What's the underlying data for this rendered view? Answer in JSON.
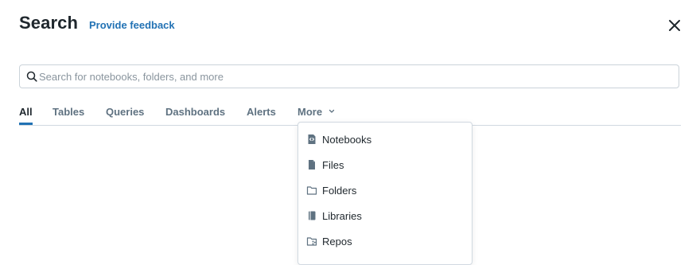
{
  "header": {
    "title": "Search",
    "feedback_link": "Provide feedback",
    "close_icon": "close-icon"
  },
  "search": {
    "placeholder": "Search for notebooks, folders, and more",
    "value": "",
    "icon": "search-icon"
  },
  "tabs": [
    {
      "label": "All",
      "active": true
    },
    {
      "label": "Tables",
      "active": false
    },
    {
      "label": "Queries",
      "active": false
    },
    {
      "label": "Dashboards",
      "active": false
    },
    {
      "label": "Alerts",
      "active": false
    },
    {
      "label": "More",
      "active": false,
      "icon": "chevron-down-icon"
    }
  ],
  "more_menu": {
    "items": [
      {
        "label": "Notebooks",
        "icon": "notebook-icon"
      },
      {
        "label": "Files",
        "icon": "file-icon"
      },
      {
        "label": "Folders",
        "icon": "folder-icon"
      },
      {
        "label": "Libraries",
        "icon": "library-icon"
      },
      {
        "label": "Repos",
        "icon": "repo-icon"
      }
    ]
  },
  "colors": {
    "accent": "#2272b4",
    "text": "#1f272d",
    "muted": "#5f7281",
    "border": "#d1d9e1"
  }
}
